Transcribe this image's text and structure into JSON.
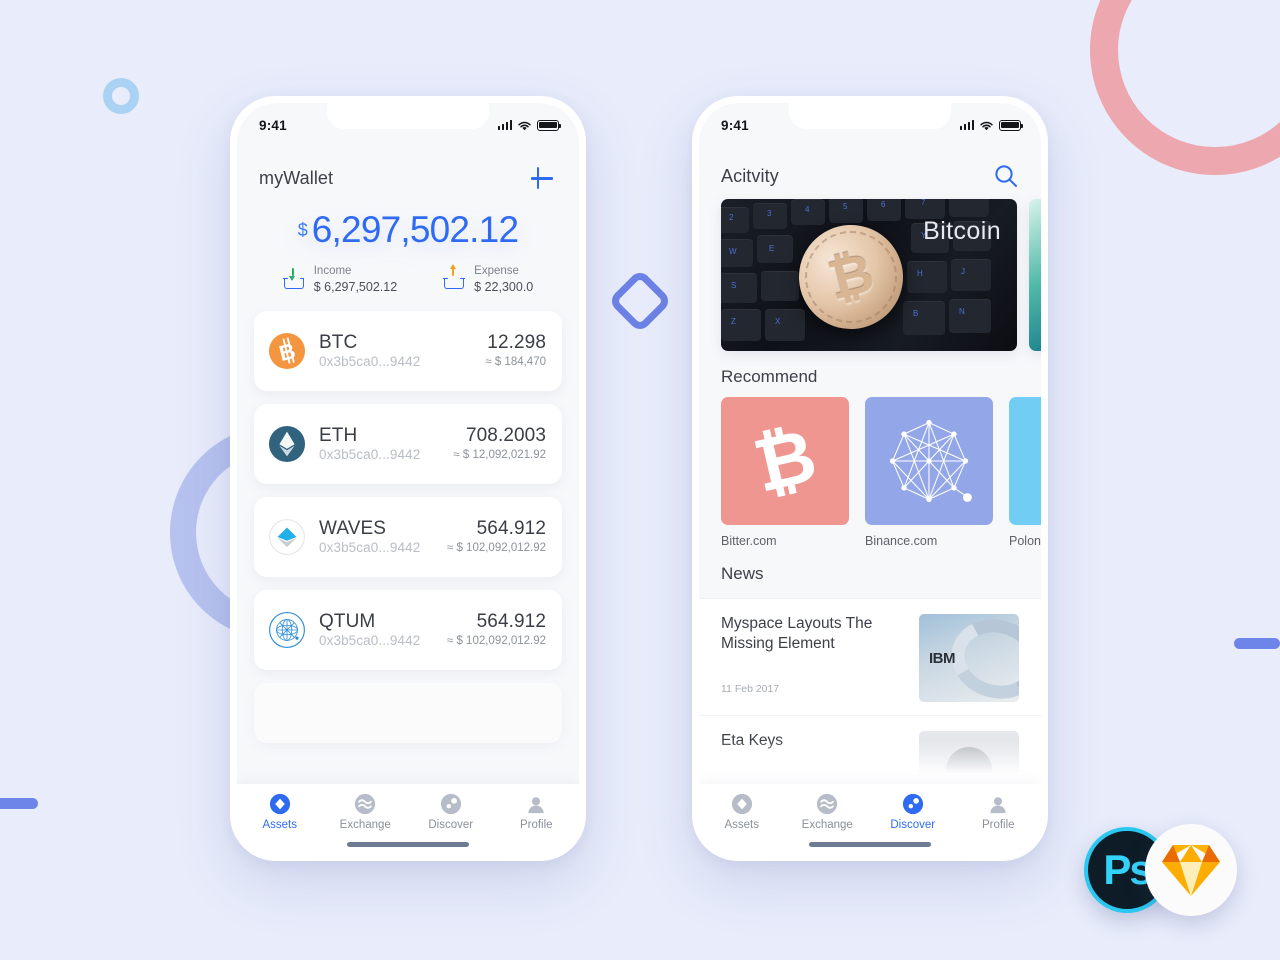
{
  "canvas": {
    "background": "#e8ecfb"
  },
  "decor": {
    "ring_pink": "#eda7ae",
    "ring_blue_small": "#a9d2f5",
    "ring_lavender": "#b7c2ef",
    "bar": "#6d85e8",
    "diamond": "#6d82e6"
  },
  "phone_assets": {
    "status": {
      "time": "9:41",
      "signal_icon": "signal-bars-icon",
      "wifi_icon": "wifi-icon",
      "battery_icon": "battery-full-icon"
    },
    "header": {
      "title": "myWallet",
      "add_icon": "plus-icon"
    },
    "balance": {
      "currency_symbol": "$",
      "amount": "6,297,502.12",
      "color": "#2f6bf2"
    },
    "income": {
      "label": "Income",
      "value": "$ 6,297,502.12",
      "icon": "download-tray-icon",
      "arrow_color": "#27ae60"
    },
    "expense": {
      "label": "Expense",
      "value": "$ 22,300.0",
      "icon": "upload-tray-icon",
      "arrow_color": "#f0a020"
    },
    "assets": [
      {
        "symbol": "BTC",
        "address": "0x3b5ca0...9442",
        "amount": "12.298",
        "fiat": "≈ $ 184,470",
        "icon": "bitcoin-coin-icon",
        "color": "#f4963f"
      },
      {
        "symbol": "ETH",
        "address": "0x3b5ca0...9442",
        "amount": "708.2003",
        "fiat": "≈ $ 12,092,021.92",
        "icon": "ethereum-coin-icon",
        "color": "#31637f"
      },
      {
        "symbol": "WAVES",
        "address": "0x3b5ca0...9442",
        "amount": "564.912",
        "fiat": "≈ $ 102,092,012.92",
        "icon": "waves-coin-icon",
        "color": "#21b0e8"
      },
      {
        "symbol": "QTUM",
        "address": "0x3b5ca0...9442",
        "amount": "564.912",
        "fiat": "≈ $ 102,092,012.92",
        "icon": "qtum-coin-icon",
        "color": "#2d8cdb"
      }
    ],
    "tabs": [
      {
        "label": "Assets",
        "icon": "diamond-badge-icon",
        "active": true
      },
      {
        "label": "Exchange",
        "icon": "waves-swap-icon",
        "active": false
      },
      {
        "label": "Discover",
        "icon": "compass-icon",
        "active": false
      },
      {
        "label": "Profile",
        "icon": "person-icon",
        "active": false
      }
    ]
  },
  "phone_discover": {
    "status": {
      "time": "9:41",
      "signal_icon": "signal-bars-icon",
      "wifi_icon": "wifi-icon",
      "battery_icon": "battery-full-icon"
    },
    "header": {
      "title": "Acitvity",
      "search_icon": "search-icon"
    },
    "banners": [
      {
        "caption": "Bitcoin",
        "image": "bitcoin-coin-on-keyboard-photo"
      },
      {
        "caption": "",
        "image": "teal-abstract-photo"
      }
    ],
    "recommend": {
      "title": "Recommend",
      "items": [
        {
          "name": "Bitter.com",
          "icon": "bitcoin-b-icon",
          "color": "#f09691"
        },
        {
          "name": "Binance.com",
          "icon": "network-graph-icon",
          "color": "#93a7e8"
        },
        {
          "name": "Poloniex",
          "icon": "cloud-icon",
          "color": "#72cdf4"
        }
      ]
    },
    "news": {
      "title": "News",
      "items": [
        {
          "title": "Myspace Layouts The Missing Element",
          "date": "11 Feb 2017",
          "thumb": "ibm-server-photo"
        },
        {
          "title": "Eta Keys",
          "date": "",
          "thumb": "person-portrait-photo"
        }
      ]
    },
    "tabs": [
      {
        "label": "Assets",
        "icon": "diamond-badge-icon",
        "active": false
      },
      {
        "label": "Exchange",
        "icon": "waves-swap-icon",
        "active": false
      },
      {
        "label": "Discover",
        "icon": "compass-icon",
        "active": true
      },
      {
        "label": "Profile",
        "icon": "person-icon",
        "active": false
      }
    ]
  },
  "badges": [
    {
      "name": "Ps",
      "icon": "photoshop-icon"
    },
    {
      "name": "",
      "icon": "sketch-diamond-icon"
    }
  ]
}
